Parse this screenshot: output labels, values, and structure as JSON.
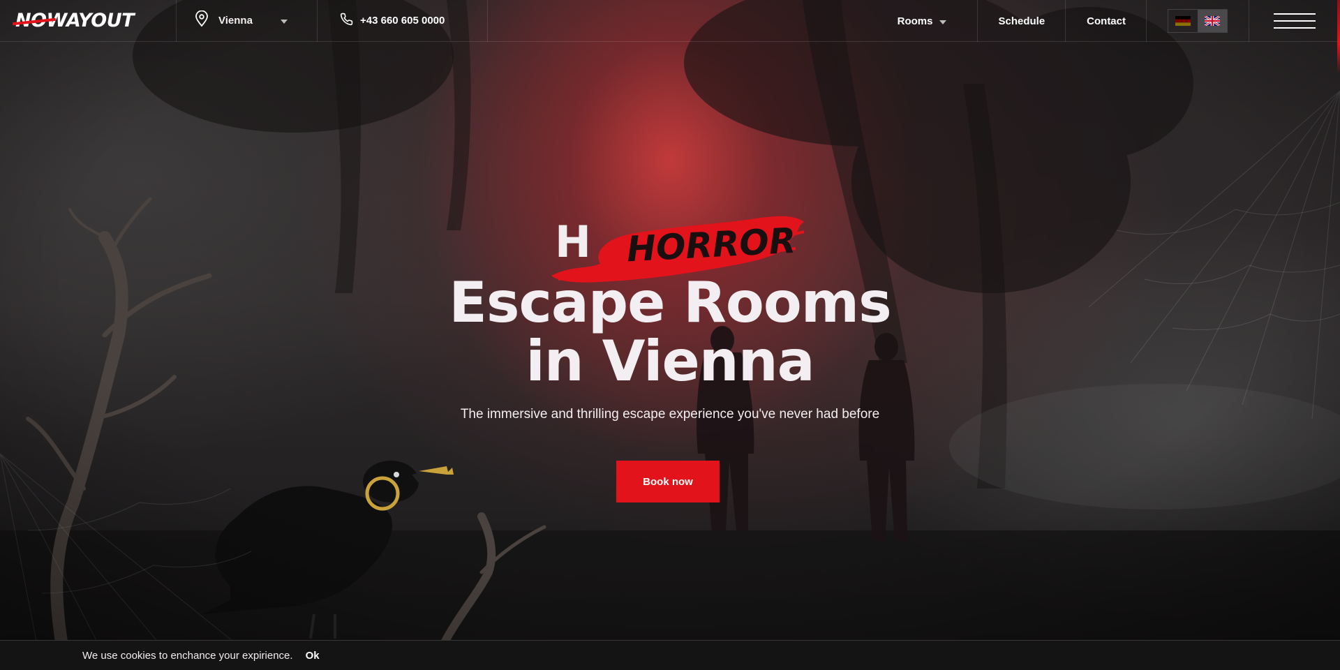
{
  "header": {
    "logo": "NOWAYOUT",
    "city": "Vienna",
    "phone": "+43 660 605 0000",
    "nav": {
      "rooms": "Rooms",
      "schedule": "Schedule",
      "contact": "Contact"
    },
    "languages": [
      "de",
      "en"
    ],
    "active_language": "en"
  },
  "hero": {
    "ghost_letter": "H",
    "highlight_word": "HORROR",
    "headline_line1": "Escape Rooms",
    "headline_line2": "in Vienna",
    "subtitle": "The immersive and thrilling escape experience you've never had before",
    "cta": "Book now"
  },
  "cookie": {
    "message": "We use cookies to enchance your expirience.",
    "ok": "Ok"
  },
  "colors": {
    "accent": "#e3131b",
    "text": "#f3eef1",
    "background": "#1c1a1b"
  }
}
